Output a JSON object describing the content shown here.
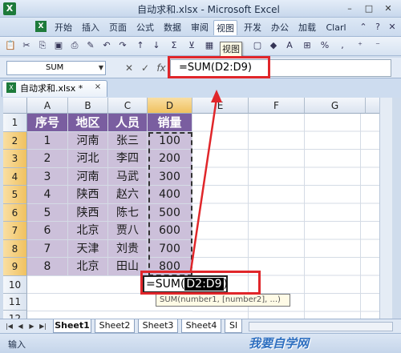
{
  "window": {
    "title": "自动求和.xlsx - Microsoft Excel",
    "minimize": "–",
    "maximize": "□",
    "close": "✕"
  },
  "ribbon": {
    "tabs": [
      "开始",
      "插入",
      "页面",
      "公式",
      "数据",
      "审阅",
      "视图",
      "开发",
      "办公",
      "加载",
      "Clarl"
    ],
    "active_tab": "视图",
    "tooltip": "视图"
  },
  "formula_bar": {
    "name_box": "SUM",
    "cancel": "✕",
    "enter": "✓",
    "fx": "fx",
    "formula": "=SUM(D2:D9)"
  },
  "workbook": {
    "tab_label": "自动求和.xlsx *",
    "close": "×"
  },
  "grid": {
    "columns": [
      "A",
      "B",
      "C",
      "D",
      "E",
      "F",
      "G"
    ],
    "rows": [
      "1",
      "2",
      "3",
      "4",
      "5",
      "6",
      "7",
      "8",
      "9",
      "10",
      "11",
      "12"
    ],
    "header_row": [
      "序号",
      "地区",
      "人员",
      "销量"
    ],
    "data_rows": [
      [
        "1",
        "河南",
        "张三",
        "100"
      ],
      [
        "2",
        "河北",
        "李四",
        "200"
      ],
      [
        "3",
        "河南",
        "马武",
        "300"
      ],
      [
        "4",
        "陕西",
        "赵六",
        "400"
      ],
      [
        "5",
        "陕西",
        "陈七",
        "500"
      ],
      [
        "6",
        "北京",
        "贾八",
        "600"
      ],
      [
        "7",
        "天津",
        "刘贵",
        "700"
      ],
      [
        "8",
        "北京",
        "田山",
        "800"
      ]
    ],
    "active_cell_prefix": "=SUM(",
    "active_cell_ref": "D2:D9",
    "active_cell_suffix": ")",
    "function_hint": "SUM(number1, [number2], ...)"
  },
  "sheets": {
    "tabs": [
      "Sheet1",
      "Sheet2",
      "Sheet3",
      "Sheet4",
      "Sl"
    ],
    "active": "Sheet1"
  },
  "status": {
    "mode": "输入",
    "watermark": "我要自学网"
  },
  "colors": {
    "header_fill": "#7a5ea0",
    "data_fill": "#ccc0da",
    "annotation_red": "#e0262a"
  }
}
